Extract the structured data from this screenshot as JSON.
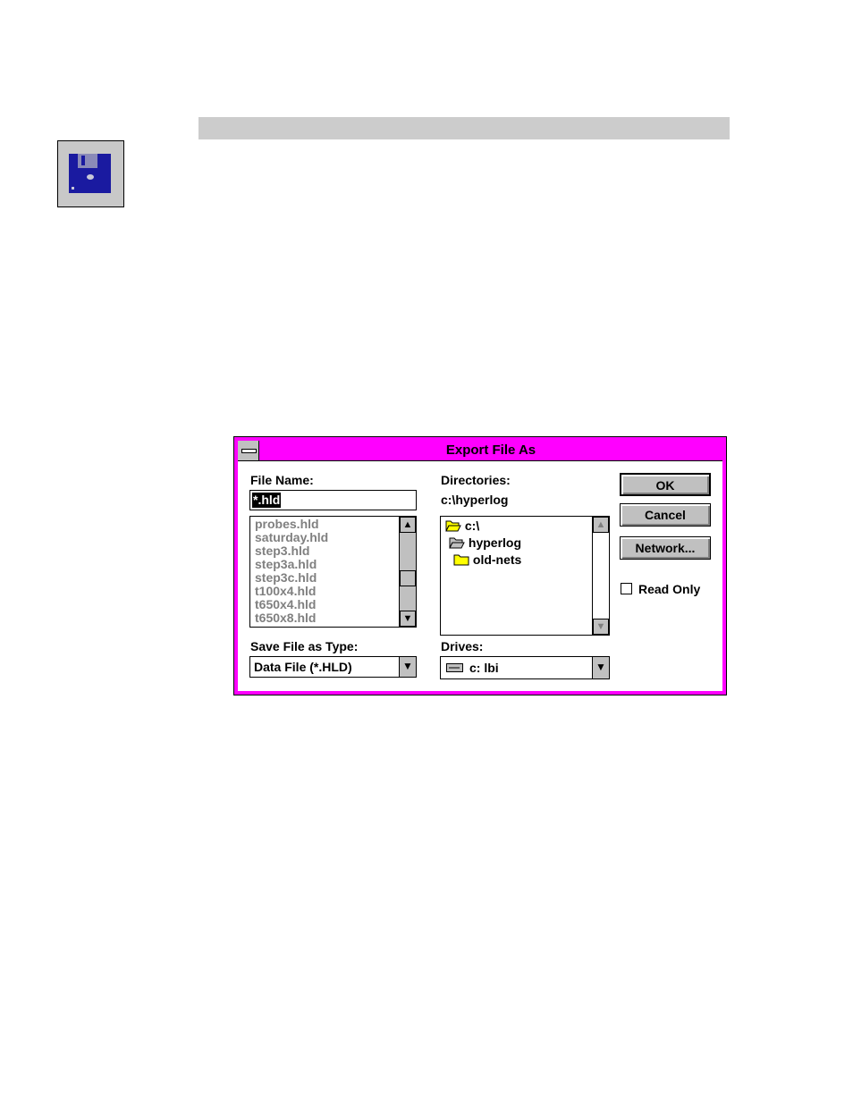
{
  "dialog": {
    "title": "Export File As",
    "file_name": {
      "label": "File Name:",
      "value": "*.hld",
      "files": [
        "probes.hld",
        "saturday.hld",
        "step3.hld",
        "step3a.hld",
        "step3c.hld",
        "t100x4.hld",
        "t650x4.hld",
        "t650x8.hld"
      ]
    },
    "directories": {
      "label": "Directories:",
      "current": "c:\\hyperlog",
      "items": [
        "c:\\",
        "hyperlog",
        "old-nets"
      ]
    },
    "save_type": {
      "label": "Save File as Type:",
      "value": "Data File (*.HLD)"
    },
    "drives": {
      "label": "Drives:",
      "value": "c: lbi"
    },
    "buttons": {
      "ok": "OK",
      "cancel": "Cancel",
      "network": "Network..."
    },
    "read_only_label": "Read Only"
  },
  "icons": [
    "save-disk-icon",
    "system-menu-icon",
    "folder-open-icon",
    "folder-icon",
    "drive-icon",
    "arrow-up-icon",
    "arrow-down-icon"
  ],
  "colors": {
    "dialog_frame": "#ff00ff",
    "disk_blue": "#1a1aa0",
    "button_face": "#c0c0c0"
  }
}
